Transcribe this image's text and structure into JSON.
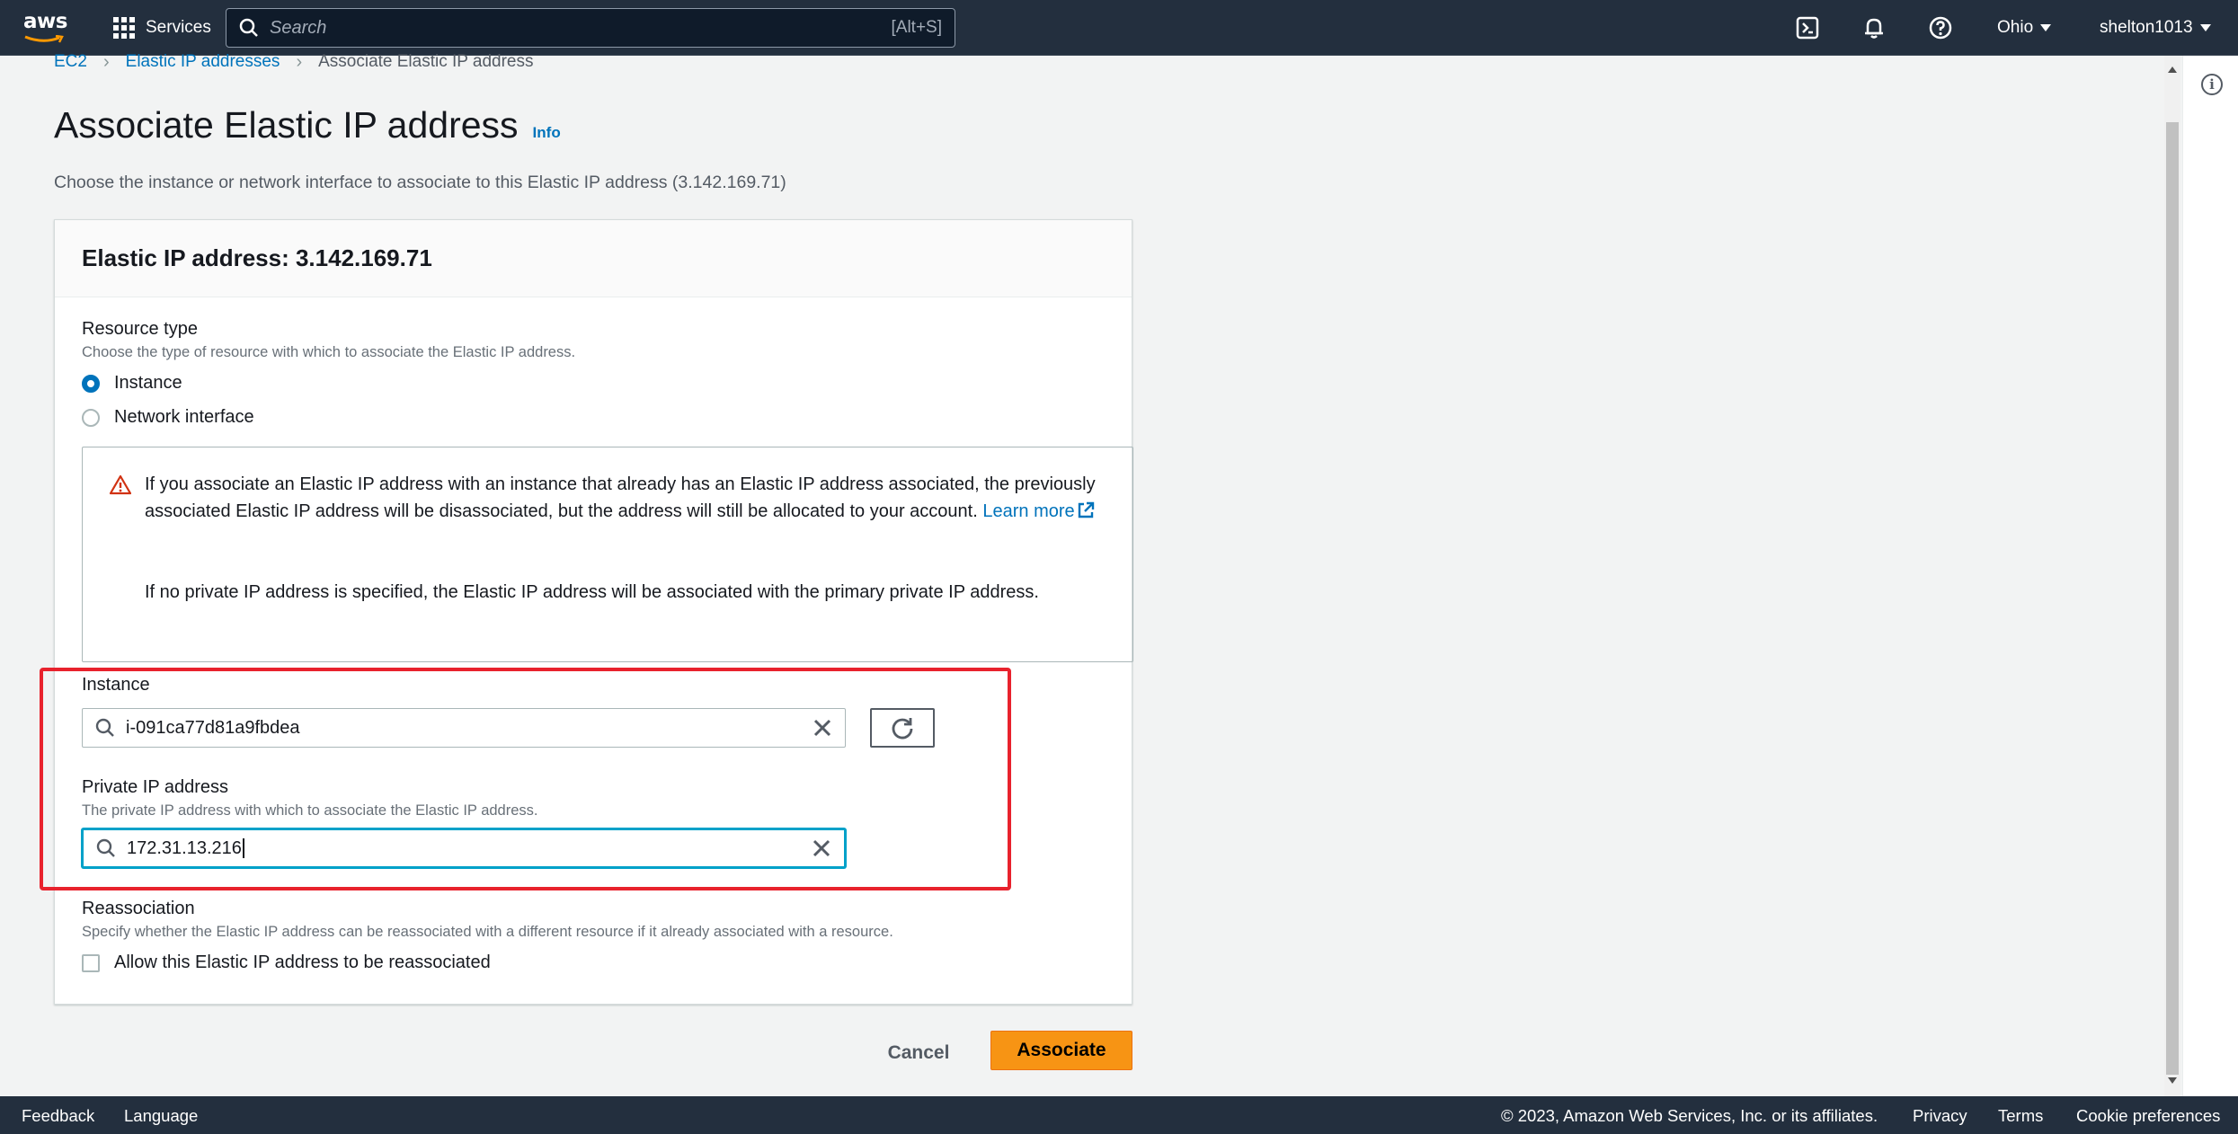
{
  "topnav": {
    "logo_text": "aws",
    "services_label": "Services",
    "search_placeholder": "Search",
    "search_shortcut": "[Alt+S]",
    "region": "Ohio",
    "user": "shelton1013"
  },
  "breadcrumb": {
    "items": [
      "EC2",
      "Elastic IP addresses",
      "Associate Elastic IP address"
    ]
  },
  "page": {
    "title": "Associate Elastic IP address",
    "info_link": "Info",
    "description": "Choose the instance or network interface to associate to this Elastic IP address (3.142.169.71)"
  },
  "panel": {
    "header": "Elastic IP address: 3.142.169.71",
    "resource_type": {
      "label": "Resource type",
      "description": "Choose the type of resource with which to associate the Elastic IP address.",
      "options": [
        "Instance",
        "Network interface"
      ],
      "selected": "Instance"
    },
    "alert": {
      "text1": "If you associate an Elastic IP address with an instance that already has an Elastic IP address associated, the previously associated Elastic IP address will be disassociated, but the address will still be allocated to your account.",
      "learn_more": "Learn more",
      "text2": "If no private IP address is specified, the Elastic IP address will be associated with the primary private IP address."
    },
    "instance": {
      "label": "Instance",
      "value": "i-091ca77d81a9fbdea"
    },
    "private_ip": {
      "label": "Private IP address",
      "description": "The private IP address with which to associate the Elastic IP address.",
      "value": "172.31.13.216"
    },
    "reassociation": {
      "label": "Reassociation",
      "description": "Specify whether the Elastic IP address can be reassociated with a different resource if it already associated with a resource.",
      "checkbox_label": "Allow this Elastic IP address to be reassociated",
      "checked": false
    }
  },
  "actions": {
    "cancel": "Cancel",
    "associate": "Associate"
  },
  "footer": {
    "feedback": "Feedback",
    "language": "Language",
    "copyright": "© 2023, Amazon Web Services, Inc. or its affiliates.",
    "privacy": "Privacy",
    "terms": "Terms",
    "cookie": "Cookie preferences"
  },
  "colors": {
    "nav_bg": "#232f3e",
    "link": "#0073bb",
    "primary_button": "#f79414",
    "highlight_box": "#e8222d",
    "warning": "#d13212"
  }
}
